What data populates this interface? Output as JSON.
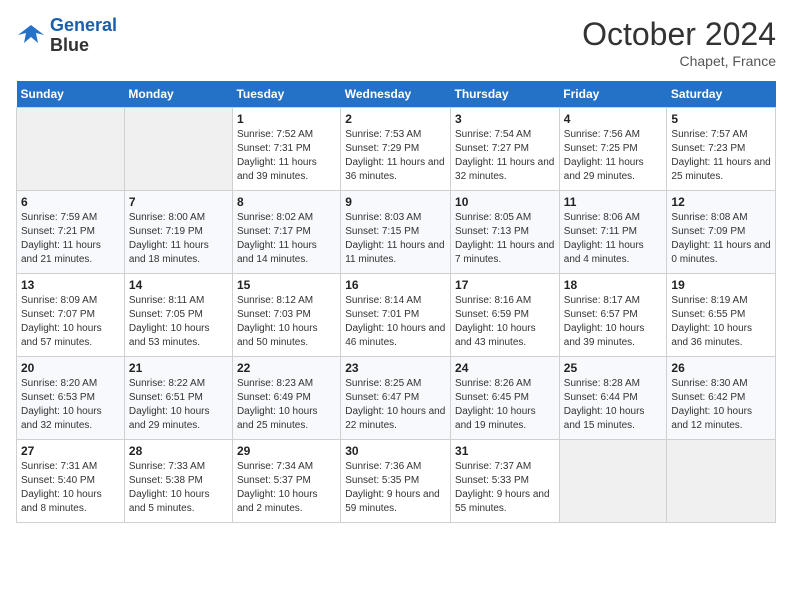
{
  "header": {
    "logo_line1": "General",
    "logo_line2": "Blue",
    "month": "October 2024",
    "location": "Chapet, France"
  },
  "columns": [
    "Sunday",
    "Monday",
    "Tuesday",
    "Wednesday",
    "Thursday",
    "Friday",
    "Saturday"
  ],
  "weeks": [
    [
      {
        "day": "",
        "detail": ""
      },
      {
        "day": "",
        "detail": ""
      },
      {
        "day": "1",
        "detail": "Sunrise: 7:52 AM\nSunset: 7:31 PM\nDaylight: 11 hours and 39 minutes."
      },
      {
        "day": "2",
        "detail": "Sunrise: 7:53 AM\nSunset: 7:29 PM\nDaylight: 11 hours and 36 minutes."
      },
      {
        "day": "3",
        "detail": "Sunrise: 7:54 AM\nSunset: 7:27 PM\nDaylight: 11 hours and 32 minutes."
      },
      {
        "day": "4",
        "detail": "Sunrise: 7:56 AM\nSunset: 7:25 PM\nDaylight: 11 hours and 29 minutes."
      },
      {
        "day": "5",
        "detail": "Sunrise: 7:57 AM\nSunset: 7:23 PM\nDaylight: 11 hours and 25 minutes."
      }
    ],
    [
      {
        "day": "6",
        "detail": "Sunrise: 7:59 AM\nSunset: 7:21 PM\nDaylight: 11 hours and 21 minutes."
      },
      {
        "day": "7",
        "detail": "Sunrise: 8:00 AM\nSunset: 7:19 PM\nDaylight: 11 hours and 18 minutes."
      },
      {
        "day": "8",
        "detail": "Sunrise: 8:02 AM\nSunset: 7:17 PM\nDaylight: 11 hours and 14 minutes."
      },
      {
        "day": "9",
        "detail": "Sunrise: 8:03 AM\nSunset: 7:15 PM\nDaylight: 11 hours and 11 minutes."
      },
      {
        "day": "10",
        "detail": "Sunrise: 8:05 AM\nSunset: 7:13 PM\nDaylight: 11 hours and 7 minutes."
      },
      {
        "day": "11",
        "detail": "Sunrise: 8:06 AM\nSunset: 7:11 PM\nDaylight: 11 hours and 4 minutes."
      },
      {
        "day": "12",
        "detail": "Sunrise: 8:08 AM\nSunset: 7:09 PM\nDaylight: 11 hours and 0 minutes."
      }
    ],
    [
      {
        "day": "13",
        "detail": "Sunrise: 8:09 AM\nSunset: 7:07 PM\nDaylight: 10 hours and 57 minutes."
      },
      {
        "day": "14",
        "detail": "Sunrise: 8:11 AM\nSunset: 7:05 PM\nDaylight: 10 hours and 53 minutes."
      },
      {
        "day": "15",
        "detail": "Sunrise: 8:12 AM\nSunset: 7:03 PM\nDaylight: 10 hours and 50 minutes."
      },
      {
        "day": "16",
        "detail": "Sunrise: 8:14 AM\nSunset: 7:01 PM\nDaylight: 10 hours and 46 minutes."
      },
      {
        "day": "17",
        "detail": "Sunrise: 8:16 AM\nSunset: 6:59 PM\nDaylight: 10 hours and 43 minutes."
      },
      {
        "day": "18",
        "detail": "Sunrise: 8:17 AM\nSunset: 6:57 PM\nDaylight: 10 hours and 39 minutes."
      },
      {
        "day": "19",
        "detail": "Sunrise: 8:19 AM\nSunset: 6:55 PM\nDaylight: 10 hours and 36 minutes."
      }
    ],
    [
      {
        "day": "20",
        "detail": "Sunrise: 8:20 AM\nSunset: 6:53 PM\nDaylight: 10 hours and 32 minutes."
      },
      {
        "day": "21",
        "detail": "Sunrise: 8:22 AM\nSunset: 6:51 PM\nDaylight: 10 hours and 29 minutes."
      },
      {
        "day": "22",
        "detail": "Sunrise: 8:23 AM\nSunset: 6:49 PM\nDaylight: 10 hours and 25 minutes."
      },
      {
        "day": "23",
        "detail": "Sunrise: 8:25 AM\nSunset: 6:47 PM\nDaylight: 10 hours and 22 minutes."
      },
      {
        "day": "24",
        "detail": "Sunrise: 8:26 AM\nSunset: 6:45 PM\nDaylight: 10 hours and 19 minutes."
      },
      {
        "day": "25",
        "detail": "Sunrise: 8:28 AM\nSunset: 6:44 PM\nDaylight: 10 hours and 15 minutes."
      },
      {
        "day": "26",
        "detail": "Sunrise: 8:30 AM\nSunset: 6:42 PM\nDaylight: 10 hours and 12 minutes."
      }
    ],
    [
      {
        "day": "27",
        "detail": "Sunrise: 7:31 AM\nSunset: 5:40 PM\nDaylight: 10 hours and 8 minutes."
      },
      {
        "day": "28",
        "detail": "Sunrise: 7:33 AM\nSunset: 5:38 PM\nDaylight: 10 hours and 5 minutes."
      },
      {
        "day": "29",
        "detail": "Sunrise: 7:34 AM\nSunset: 5:37 PM\nDaylight: 10 hours and 2 minutes."
      },
      {
        "day": "30",
        "detail": "Sunrise: 7:36 AM\nSunset: 5:35 PM\nDaylight: 9 hours and 59 minutes."
      },
      {
        "day": "31",
        "detail": "Sunrise: 7:37 AM\nSunset: 5:33 PM\nDaylight: 9 hours and 55 minutes."
      },
      {
        "day": "",
        "detail": ""
      },
      {
        "day": "",
        "detail": ""
      }
    ]
  ]
}
